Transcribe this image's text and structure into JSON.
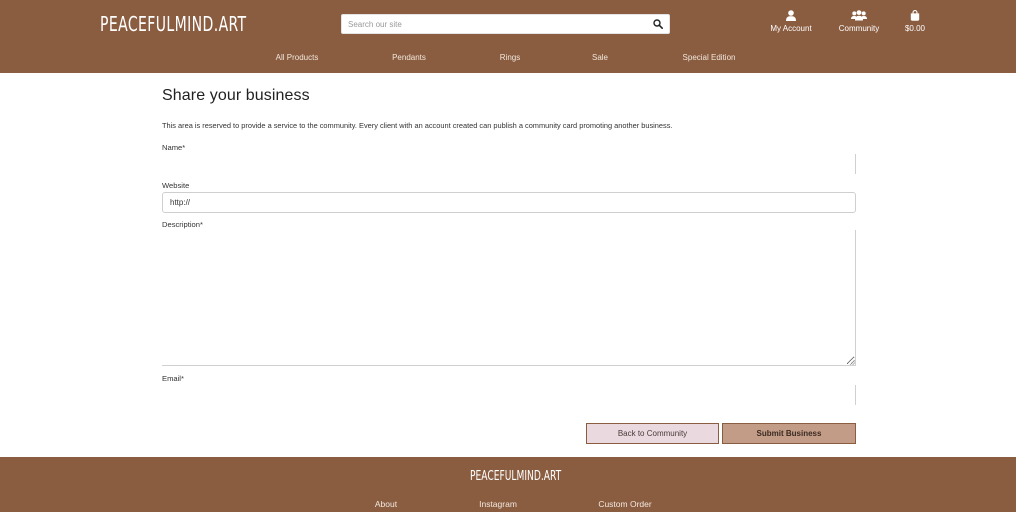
{
  "header": {
    "logo": "PEACEFULMIND.ART",
    "search_placeholder": "Search our site",
    "account_label": "My Account",
    "community_label": "Community",
    "bag_total": "$0.00"
  },
  "nav": {
    "items": [
      "All Products",
      "Pendants",
      "Rings",
      "Sale",
      "Special Edition"
    ]
  },
  "form": {
    "title": "Share your business",
    "intro": "This area is reserved to provide a service to the community. Every client with an account created can publish a community card promoting another business.",
    "name_label": "Name*",
    "website_label": "Website",
    "website_value": "http://",
    "description_label": "Description*",
    "email_label": "Email*",
    "back_button": "Back to Community",
    "submit_button": "Submit Business"
  },
  "footer": {
    "logo": "PEACEFULMIND.ART",
    "links": [
      "About",
      "Instagram",
      "Custom Order"
    ]
  },
  "colors": {
    "brand_brown": "#8a5c40",
    "back_button_bg": "#ead9de",
    "submit_button_bg": "#c39c87"
  },
  "icons": [
    "search-icon",
    "user-icon",
    "users-icon",
    "shopping-bag-icon"
  ]
}
